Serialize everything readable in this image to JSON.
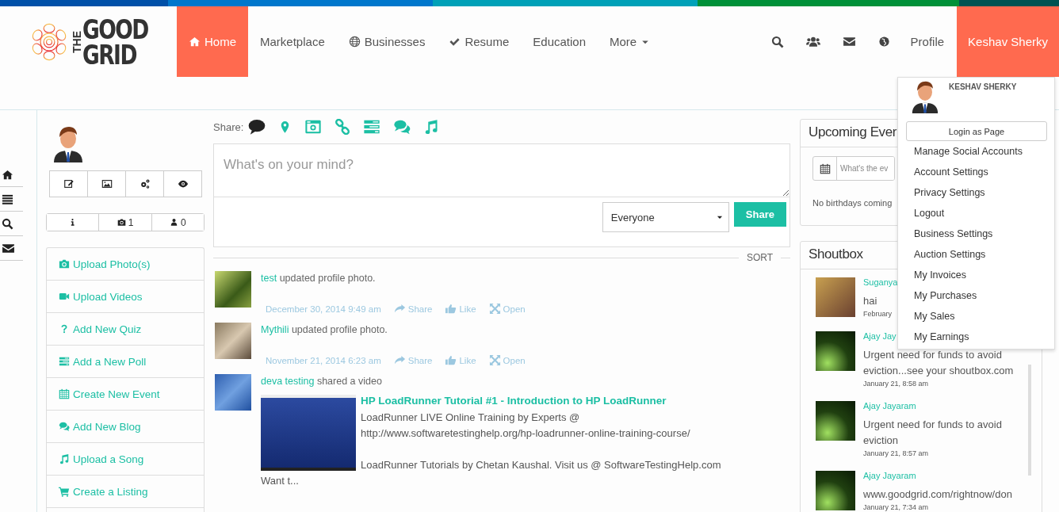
{
  "logo": {
    "word_1": "THE",
    "word_2": "GOOD",
    "word_3": "GRID"
  },
  "nav": [
    {
      "label": "Home",
      "selected": true
    },
    {
      "label": "Marketplace",
      "selected": false
    },
    {
      "label": "Businesses",
      "selected": false
    },
    {
      "label": "Resume",
      "selected": false
    },
    {
      "label": "Education",
      "selected": false
    },
    {
      "label": "More",
      "selected": false
    }
  ],
  "profile_link": "Profile",
  "user_menu": {
    "label": "Keshav Sherky",
    "expanded": true,
    "name": "KESHAV SHERKY",
    "login_button": "Login as Page",
    "items": [
      "Manage Social Accounts",
      "Account Settings",
      "Privacy Settings",
      "Logout",
      "Business Settings",
      "Auction Settings",
      "My Invoices",
      "My Purchases",
      "My Sales",
      "My Earnings"
    ]
  },
  "profile": {
    "stats": [
      "1",
      "0"
    ],
    "menu": [
      "Upload Photo(s)",
      "Upload Videos",
      "Add New Quiz",
      "Add a New Poll",
      "Create New Event",
      "Add New Blog",
      "Upload a Song",
      "Create a Listing"
    ]
  },
  "composer": {
    "share_label": "Share:",
    "share_options": [
      {
        "selected": true
      },
      {
        "selected": false
      },
      {
        "selected": false
      },
      {
        "selected": false
      },
      {
        "selected": false
      },
      {
        "selected": false
      },
      {
        "selected": false
      }
    ],
    "placeholder": "What's on your mind?",
    "audience": "Everyone",
    "button": "Share",
    "sort": "SORT"
  },
  "posts": [
    {
      "author": "test",
      "action": "updated profile photo.",
      "date": "December 30, 2014 9:49 am",
      "actions": [
        "Share",
        "Like",
        "Open"
      ]
    },
    {
      "author": "Mythili",
      "action": "updated profile photo.",
      "date": "November 21, 2014 6:23 am",
      "actions": [
        "Share",
        "Like",
        "Open"
      ]
    },
    {
      "author": "deva testing",
      "action": "shared a video",
      "video": {
        "title": "HP LoadRunner Tutorial #1 - Introduction to HP LoadRunner",
        "description": "LoadRunner LIVE Online Training by Experts @\nhttp://www.softwaretestinghelp.org/hp-loadrunner-online-training-course/\n\nLoadRunner Tutorials by Chetan Kaushal. Visit us @ SoftwareTestingHelp.com"
      },
      "more": "Want t..."
    }
  ],
  "events": {
    "title": "Upcoming Ever",
    "placeholder": "What's the ev",
    "empty": "No birthdays coming"
  },
  "shoutbox": {
    "title": "Shoutbox",
    "entries": [
      {
        "name": "Suganya",
        "text": "hai",
        "time": "February"
      },
      {
        "name": "Ajay Jay",
        "text": "Urgent need for funds to avoid eviction...see your shoutbox.com",
        "time": "January 21, 8:58 am"
      },
      {
        "name": "Ajay Jayaram",
        "text": "Urgent need for funds to avoid eviction",
        "time": "January 21, 8:57 am"
      },
      {
        "name": "Ajay Jayaram",
        "text": "www.goodgrid.com/rightnow/don",
        "time": "January 21, 7:34 am"
      }
    ]
  }
}
